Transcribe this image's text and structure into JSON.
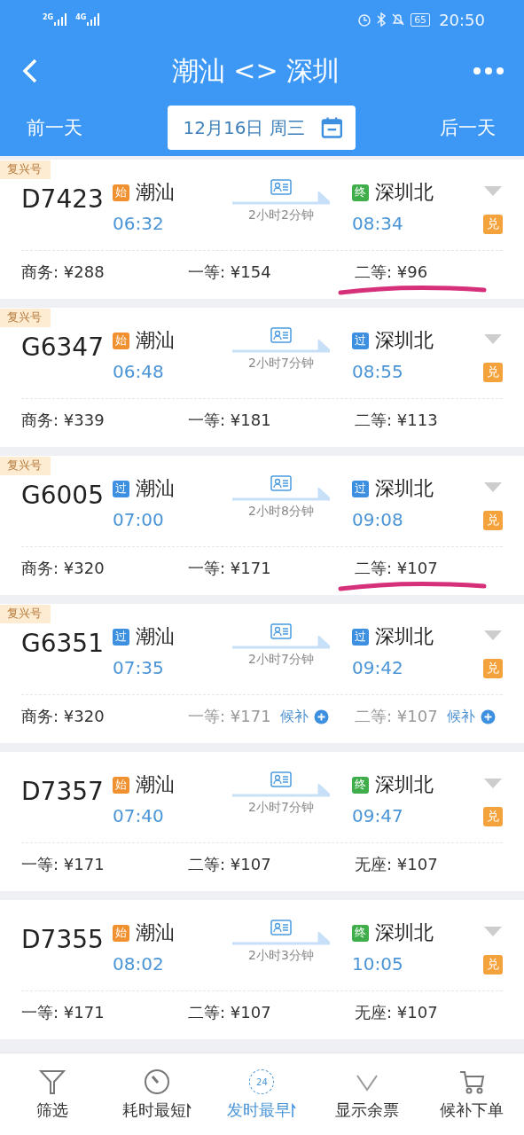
{
  "status_bar": {
    "networks": [
      "2G",
      "4G"
    ],
    "battery": "65",
    "time": "20:50"
  },
  "header": {
    "title": "潮汕 <> 深圳",
    "prev_day": "前一天",
    "date": "12月16日 周三",
    "next_day": "后一天"
  },
  "trains": [
    {
      "tag": "复兴号",
      "number": "D7423",
      "from": {
        "badge": "始",
        "kind": "start",
        "station": "潮汕",
        "time": "06:32"
      },
      "duration": "2小时2分钟",
      "to": {
        "badge": "终",
        "kind": "end",
        "station": "深圳北",
        "time": "08:34"
      },
      "exchange": "兑",
      "prices": [
        {
          "label": "商务:",
          "price": "¥288",
          "available": true,
          "marked": false
        },
        {
          "label": "一等:",
          "price": "¥154",
          "available": true,
          "marked": false
        },
        {
          "label": "二等:",
          "price": "¥96",
          "available": true,
          "marked": true
        }
      ]
    },
    {
      "tag": "复兴号",
      "number": "G6347",
      "from": {
        "badge": "始",
        "kind": "start",
        "station": "潮汕",
        "time": "06:48"
      },
      "duration": "2小时7分钟",
      "to": {
        "badge": "过",
        "kind": "pass",
        "station": "深圳北",
        "time": "08:55"
      },
      "exchange": "兑",
      "prices": [
        {
          "label": "商务:",
          "price": "¥339",
          "available": true,
          "marked": false
        },
        {
          "label": "一等:",
          "price": "¥181",
          "available": true,
          "marked": false
        },
        {
          "label": "二等:",
          "price": "¥113",
          "available": true,
          "marked": false
        }
      ]
    },
    {
      "tag": "复兴号",
      "number": "G6005",
      "from": {
        "badge": "过",
        "kind": "pass",
        "station": "潮汕",
        "time": "07:00"
      },
      "duration": "2小时8分钟",
      "to": {
        "badge": "过",
        "kind": "pass",
        "station": "深圳北",
        "time": "09:08"
      },
      "exchange": "兑",
      "prices": [
        {
          "label": "商务:",
          "price": "¥320",
          "available": true,
          "marked": false
        },
        {
          "label": "一等:",
          "price": "¥171",
          "available": true,
          "marked": false
        },
        {
          "label": "二等:",
          "price": "¥107",
          "available": true,
          "marked": true
        }
      ]
    },
    {
      "tag": "复兴号",
      "number": "G6351",
      "from": {
        "badge": "过",
        "kind": "pass",
        "station": "潮汕",
        "time": "07:35"
      },
      "duration": "2小时7分钟",
      "to": {
        "badge": "过",
        "kind": "pass",
        "station": "深圳北",
        "time": "09:42"
      },
      "exchange": "兑",
      "prices": [
        {
          "label": "商务:",
          "price": "¥320",
          "available": true,
          "marked": false
        },
        {
          "label": "一等:",
          "price": "¥171",
          "available": false,
          "waitlist": "候补",
          "marked": false
        },
        {
          "label": "二等:",
          "price": "¥107",
          "available": false,
          "waitlist": "候补",
          "marked": false
        }
      ]
    },
    {
      "number": "D7357",
      "from": {
        "badge": "始",
        "kind": "start",
        "station": "潮汕",
        "time": "07:40"
      },
      "duration": "2小时7分钟",
      "to": {
        "badge": "终",
        "kind": "end",
        "station": "深圳北",
        "time": "09:47"
      },
      "exchange": "兑",
      "prices": [
        {
          "label": "一等:",
          "price": "¥171",
          "available": true,
          "marked": false
        },
        {
          "label": "二等:",
          "price": "¥107",
          "available": true,
          "marked": false
        },
        {
          "label": "无座:",
          "price": "¥107",
          "available": true,
          "marked": false
        }
      ]
    },
    {
      "number": "D7355",
      "from": {
        "badge": "始",
        "kind": "start",
        "station": "潮汕",
        "time": "08:02"
      },
      "duration": "2小时3分钟",
      "to": {
        "badge": "终",
        "kind": "end",
        "station": "深圳北",
        "time": "10:05"
      },
      "exchange": "兑",
      "prices": [
        {
          "label": "一等:",
          "price": "¥171",
          "available": true,
          "marked": false
        },
        {
          "label": "二等:",
          "price": "¥107",
          "available": true,
          "marked": false
        },
        {
          "label": "无座:",
          "price": "¥107",
          "available": true,
          "marked": false
        }
      ]
    }
  ],
  "bottom_bar": [
    {
      "kind": "filter",
      "label": "筛选",
      "sortable": false,
      "selected": false
    },
    {
      "kind": "timer",
      "label": "耗时最短",
      "sortable": true,
      "selected": false
    },
    {
      "kind": "clock",
      "icon_text": "24",
      "label": "发时最早",
      "sortable": true,
      "selected": true
    },
    {
      "kind": "tickets",
      "label": "显示余票",
      "sortable": false,
      "selected": false
    },
    {
      "kind": "cart",
      "label": "候补下单",
      "sortable": false,
      "selected": false
    }
  ]
}
